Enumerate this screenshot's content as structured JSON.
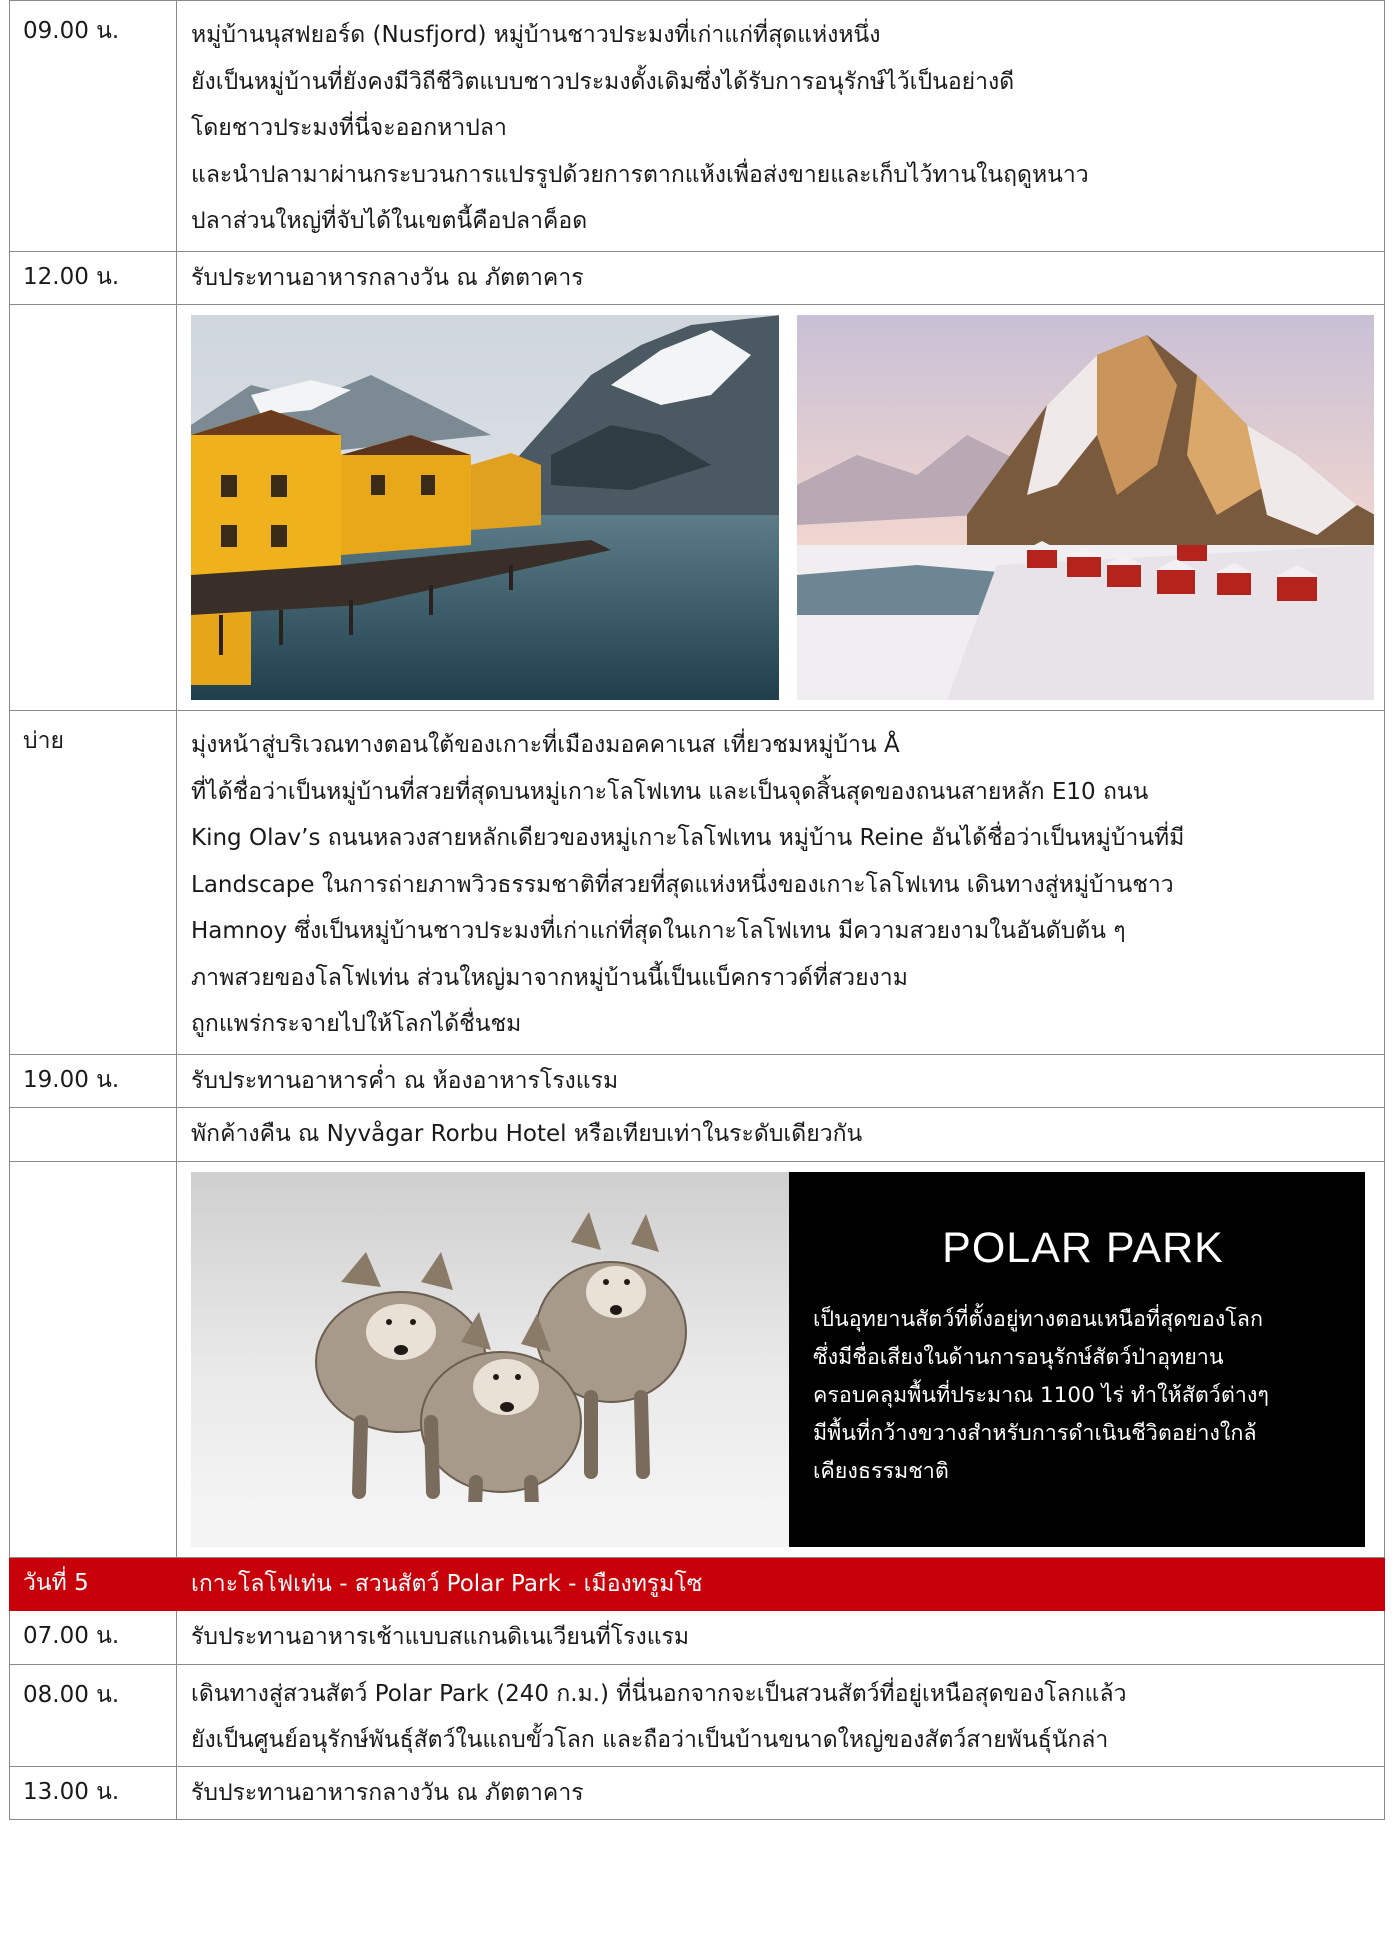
{
  "rows": [
    {
      "time": "09.00 น.",
      "lines": [
        "หมู่บ้านนุสฟยอร์ด (Nusfjord) หมู่บ้านชาวประมงที่เก่าแก่ที่สุดแห่งหนึ่ง",
        "ยังเป็นหมู่บ้านที่ยังคงมีวิถีชีวิตแบบชาวประมงดั้งเดิมซึ่งได้รับการอนุรักษ์ไว้เป็นอย่างดี",
        "โดยชาวประมงที่นี่จะออกหาปลา",
        "และนำปลามาผ่านกระบวนการแปรรูปด้วยการตากแห้งเพื่อส่งขายและเก็บไว้ทานในฤดูหนาว",
        "ปลาส่วนใหญ่ที่จับได้ในเขตนี้คือปลาค็อด"
      ]
    },
    {
      "time": "12.00 น.",
      "text": "รับประทานอาหารกลางวัน ณ ภัตตาคาร"
    },
    {
      "time": "บ่าย",
      "lines": [
        "มุ่งหน้าสู่บริเวณทางตอนใต้ของเกาะที่เมืองมอคคาเนส เที่ยวชมหมู่บ้าน Å",
        "ที่ได้ชื่อว่าเป็นหมู่บ้านที่สวยที่สุดบนหมู่เกาะโลโฟเทน และเป็นจุดสิ้นสุดของถนนสายหลัก E10 ถนน",
        "King Olav’s ถนนหลวงสายหลักเดียวของหมู่เกาะโลโฟเทน หมู่บ้าน Reine อันได้ชื่อว่าเป็นหมู่บ้านที่มี",
        "Landscape ในการถ่ายภาพวิวธรรมชาติที่สวยที่สุดแห่งหนึ่งของเกาะโลโฟเทน เดินทางสู่หมู่บ้านชาว",
        "Hamnoy ซึ่งเป็นหมู่บ้านชาวประมงที่เก่าแก่ที่สุดในเกาะโลโฟเทน มีความสวยงามในอันดับต้น ๆ",
        "ภาพสวยของโลโฟเท่น ส่วนใหญ่มาจากหมู่บ้านนี้เป็นแบ็คกราวด์ที่สวยงาม",
        "ถูกแพร่กระจายไปให้โลกได้ชื่นชม"
      ]
    },
    {
      "time": "19.00 น.",
      "text": "รับประทานอาหารค่ำ ณ ห้องอาหารโรงแรม"
    },
    {
      "time": "",
      "text": "พักค้างคืน ณ Nyvågar Rorbu Hotel หรือเทียบเท่าในระดับเดียวกัน"
    },
    {
      "time": "07.00 น.",
      "text": "รับประทานอาหารเช้าแบบสแกนดิเนเวียนที่โรงแรม"
    },
    {
      "time": "08.00 น.",
      "lines": [
        "เดินทางสู่สวนสัตว์ Polar Park (240 ก.ม.) ที่นี่นอกจากจะเป็นสวนสัตว์ที่อยู่เหนือสุดของโลกแล้ว",
        "ยังเป็นศูนย์อนุรักษ์พันธุ์สัตว์ในแถบขั้วโลก และถือว่าเป็นบ้านขนาดใหญ่ของสัตว์สายพันธุ์นักล่า"
      ]
    },
    {
      "time": "13.00 น.",
      "text": "รับประทานอาหารกลางวัน ณ ภัตตาคาร"
    }
  ],
  "day_header": {
    "day": "วันที่ 5",
    "title": "เกาะโลโฟเท่น - สวนสัตว์ Polar Park - เมืองทรูมโซ"
  },
  "polar_park": {
    "title": "POLAR PARK",
    "lines": [
      "เป็นอุทยานสัตว์ที่ตั้งอยู่ทางตอนเหนือที่สุดของโลก",
      "ซึ่งมีชื่อเสียงในด้านการอนุรักษ์สัตว์ป่าอุทยาน",
      "ครอบคลุมพื้นที่ประมาณ 1100 ไร่ ทำให้สัตว์ต่างๆ",
      "มีพื้นที่กว้างขวางสำหรับการดำเนินชีวิตอย่างใกล้",
      "เคียงธรรมชาติ"
    ]
  },
  "colors": {
    "day_header_bg": "#c8000a",
    "border": "#8a8a8a"
  }
}
